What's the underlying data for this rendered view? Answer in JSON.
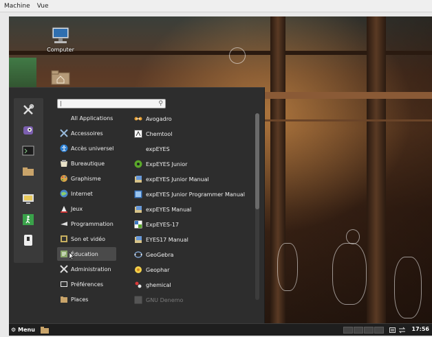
{
  "vm_menubar": {
    "machine": "Machine",
    "view": "Vue"
  },
  "desktop": {
    "icons": [
      {
        "label": "Computer"
      },
      {
        "label": ""
      }
    ]
  },
  "menu": {
    "search": {
      "value": "|"
    },
    "categories": [
      {
        "label": "All Applications",
        "icon": "none"
      },
      {
        "label": "Accessoires",
        "icon": "accessories-icon"
      },
      {
        "label": "Accès universel",
        "icon": "accessibility-icon"
      },
      {
        "label": "Bureautique",
        "icon": "office-icon"
      },
      {
        "label": "Graphisme",
        "icon": "graphics-icon"
      },
      {
        "label": "Internet",
        "icon": "internet-icon"
      },
      {
        "label": "Jeux",
        "icon": "games-icon"
      },
      {
        "label": "Programmation",
        "icon": "programming-icon"
      },
      {
        "label": "Son et vidéo",
        "icon": "media-icon"
      },
      {
        "label": "Éducation",
        "icon": "education-icon",
        "selected": true
      },
      {
        "label": "Administration",
        "icon": "administration-icon"
      },
      {
        "label": "Préférences",
        "icon": "preferences-icon"
      },
      {
        "label": "Places",
        "icon": "places-icon"
      }
    ],
    "apps": [
      {
        "label": "Avogadro",
        "icon": "avogadro-icon"
      },
      {
        "label": "Chemtool",
        "icon": "chemtool-icon"
      },
      {
        "label": "expEYES",
        "icon": "none"
      },
      {
        "label": "ExpEYES Junior",
        "icon": "expeyes-junior-icon"
      },
      {
        "label": "expEYES Junior Manual",
        "icon": "manual-icon"
      },
      {
        "label": "expEYES Junior Programmer Manual",
        "icon": "programmer-manual-icon"
      },
      {
        "label": "expEYES Manual",
        "icon": "manual-icon"
      },
      {
        "label": "ExpEYES-17",
        "icon": "expeyes17-icon"
      },
      {
        "label": "EYES17 Manual",
        "icon": "manual-icon"
      },
      {
        "label": "GeoGebra",
        "icon": "geogebra-icon"
      },
      {
        "label": "Geophar",
        "icon": "geophar-icon"
      },
      {
        "label": "ghemical",
        "icon": "ghemical-icon"
      },
      {
        "label": "GNU Denemo",
        "icon": "denemo-icon",
        "dim": true
      }
    ],
    "favorites": [
      "tools-icon",
      "eye-icon",
      "terminal-icon",
      "folder-icon",
      "lock-screen-icon",
      "logout-icon",
      "shutdown-icon"
    ]
  },
  "taskbar": {
    "menu_label": "Menu",
    "clock": "17:56"
  }
}
